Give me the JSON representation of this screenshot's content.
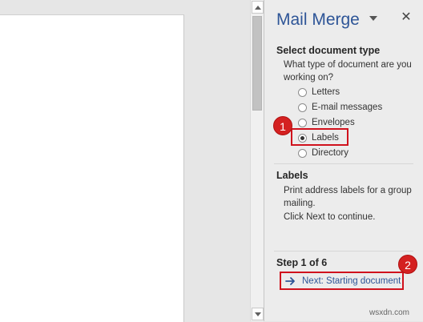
{
  "pane": {
    "title": "Mail Merge",
    "select_type": {
      "heading": "Select document type",
      "question": "What type of document are you working on?",
      "options": [
        {
          "label": "Letters",
          "checked": false
        },
        {
          "label": "E-mail messages",
          "checked": false
        },
        {
          "label": "Envelopes",
          "checked": false
        },
        {
          "label": "Labels",
          "checked": true
        },
        {
          "label": "Directory",
          "checked": false
        }
      ]
    },
    "description": {
      "heading": "Labels",
      "text": "Print address labels for a group mailing.",
      "hint": "Click Next to continue."
    },
    "step": {
      "label": "Step 1 of 6",
      "next_label": "Next: Starting document"
    }
  },
  "annotations": {
    "badge_1": "1",
    "badge_2": "2"
  },
  "watermark": "wsxdn.com",
  "colors": {
    "accent": "#2e5597",
    "highlight": "#d0121d",
    "badge": "#d42121"
  }
}
